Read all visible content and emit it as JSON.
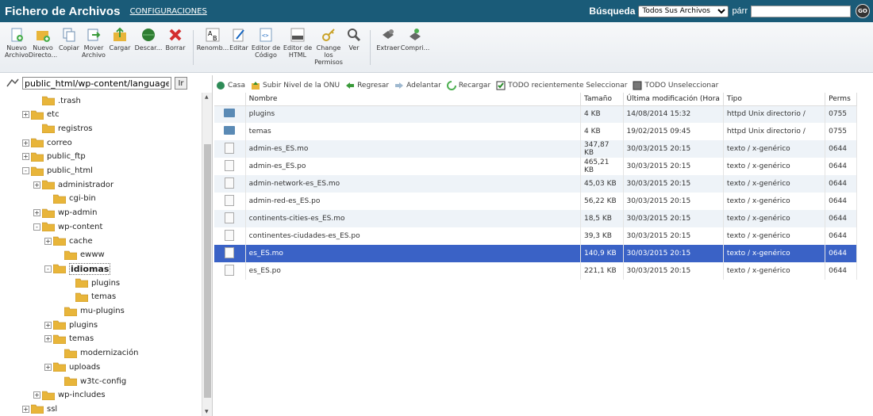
{
  "header": {
    "title": "Fichero de Archivos",
    "config_link": "CONFIGURACIONES",
    "search_label": "Búsqueda",
    "search_scope": "Todos Sus Archivos",
    "for_label": "párr",
    "search_value": "",
    "go_label": "GO"
  },
  "toolbar": {
    "items": [
      {
        "label": "Nuevo Archivo",
        "icon": "new-file-icon"
      },
      {
        "label": "Nuevo Directo...",
        "icon": "new-folder-icon"
      },
      {
        "label": "Copiar",
        "icon": "copy-icon"
      },
      {
        "label": "Mover Archivo",
        "icon": "move-icon"
      },
      {
        "label": "Cargar",
        "icon": "upload-icon"
      },
      {
        "label": "Descar...",
        "icon": "download-icon"
      },
      {
        "label": "Borrar",
        "icon": "delete-icon"
      },
      {
        "label": "Renomb...",
        "icon": "rename-icon"
      },
      {
        "label": "Editar",
        "icon": "edit-icon"
      },
      {
        "label": "Editor de Código",
        "icon": "code-editor-icon"
      },
      {
        "label": "Editor de HTML",
        "icon": "html-editor-icon"
      },
      {
        "label": "Change los Permisos",
        "icon": "permissions-icon"
      },
      {
        "label": "Ver",
        "icon": "view-icon"
      },
      {
        "label": "Extraer",
        "icon": "extract-icon"
      },
      {
        "label": "Compri...",
        "icon": "compress-icon"
      }
    ]
  },
  "tree": {
    "path": "public_html/wp-content/languages",
    "path_button": "Ir",
    "rows": [
      {
        "label": ".trash",
        "depth": 1,
        "pm": ""
      },
      {
        "label": "etc",
        "depth": 0,
        "pm": "+"
      },
      {
        "label": "registros",
        "depth": 1,
        "pm": ""
      },
      {
        "label": "correo",
        "depth": 0,
        "pm": "+"
      },
      {
        "label": "public_ftp",
        "depth": 0,
        "pm": "+"
      },
      {
        "label": "public_html",
        "depth": 0,
        "pm": "-"
      },
      {
        "label": "administrador",
        "depth": 1,
        "pm": "+"
      },
      {
        "label": "cgi-bin",
        "depth": 2,
        "pm": ""
      },
      {
        "label": "wp-admin",
        "depth": 1,
        "pm": "+"
      },
      {
        "label": "wp-content",
        "depth": 1,
        "pm": "-"
      },
      {
        "label": "cache",
        "depth": 2,
        "pm": "+"
      },
      {
        "label": "ewww",
        "depth": 3,
        "pm": ""
      },
      {
        "label": "idiomas",
        "depth": 2,
        "pm": "-",
        "selected": true
      },
      {
        "label": "plugins",
        "depth": 4,
        "pm": ""
      },
      {
        "label": "temas",
        "depth": 4,
        "pm": ""
      },
      {
        "label": "mu-plugins",
        "depth": 3,
        "pm": ""
      },
      {
        "label": "plugins",
        "depth": 2,
        "pm": "+"
      },
      {
        "label": "temas",
        "depth": 2,
        "pm": "+"
      },
      {
        "label": "modernización",
        "depth": 3,
        "pm": ""
      },
      {
        "label": "uploads",
        "depth": 2,
        "pm": "+"
      },
      {
        "label": "w3tc-config",
        "depth": 3,
        "pm": ""
      },
      {
        "label": "wp-includes",
        "depth": 1,
        "pm": "+"
      },
      {
        "label": "ssl",
        "depth": 0,
        "pm": "+"
      }
    ]
  },
  "filebar": {
    "home": "Casa",
    "up": "Subir Nivel de la ONU",
    "back": "Regresar",
    "forward": "Adelantar",
    "reload": "Recargar",
    "select_all": "TODO recientemente Seleccionar",
    "unselect_all": "TODO Unseleccionar"
  },
  "table": {
    "headers": [
      "Nombre",
      "Tamaño",
      "Última modificación (Hora",
      "Tipo",
      "Perms"
    ],
    "rows": [
      {
        "name": "plugins",
        "size": "4 KB",
        "modified": "14/08/2014 15:32",
        "type": "httpd Unix directorio /",
        "perms": "0755",
        "kind": "dir"
      },
      {
        "name": "temas",
        "size": "4 KB",
        "modified": "19/02/2015 09:45",
        "type": "httpd Unix directorio /",
        "perms": "0755",
        "kind": "dir"
      },
      {
        "name": "admin-es_ES.mo",
        "size": "347,87 KB",
        "modified": "30/03/2015 20:15",
        "type": "texto / x-genérico",
        "perms": "0644",
        "kind": "file"
      },
      {
        "name": "admin-es_ES.po",
        "size": "465,21 KB",
        "modified": "30/03/2015 20:15",
        "type": "texto / x-genérico",
        "perms": "0644",
        "kind": "file"
      },
      {
        "name": "admin-network-es_ES.mo",
        "size": "45,03 KB",
        "modified": "30/03/2015 20:15",
        "type": "texto / x-genérico",
        "perms": "0644",
        "kind": "file"
      },
      {
        "name": "admin-red-es_ES.po",
        "size": "56,22 KB",
        "modified": "30/03/2015 20:15",
        "type": "texto / x-genérico",
        "perms": "0644",
        "kind": "file"
      },
      {
        "name": "continents-cities-es_ES.mo",
        "size": "18,5 KB",
        "modified": "30/03/2015 20:15",
        "type": "texto / x-genérico",
        "perms": "0644",
        "kind": "file"
      },
      {
        "name": "continentes-ciudades-es_ES.po",
        "size": "39,3 KB",
        "modified": "30/03/2015 20:15",
        "type": "texto / x-genérico",
        "perms": "0644",
        "kind": "file"
      },
      {
        "name": "es_ES.mo",
        "size": "140,9 KB",
        "modified": "30/03/2015 20:15",
        "type": "texto / x-genérico",
        "perms": "0644",
        "kind": "file",
        "selected": true
      },
      {
        "name": "es_ES.po",
        "size": "221,1 KB",
        "modified": "30/03/2015 20:15",
        "type": "texto / x-genérico",
        "perms": "0644",
        "kind": "file"
      }
    ]
  }
}
